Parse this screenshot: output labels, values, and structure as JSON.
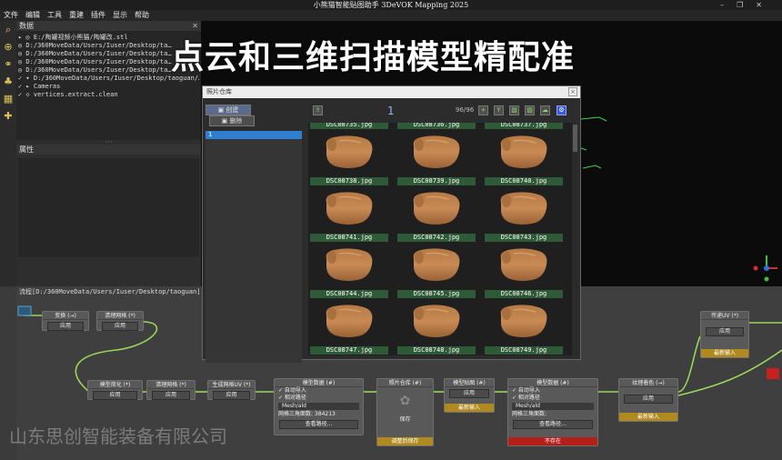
{
  "app": {
    "title": "小熊猫智能贴图助手 3DeVOK Mapping 2025"
  },
  "menu": [
    "文件",
    "编辑",
    "工具",
    "重建",
    "插件",
    "显示",
    "帮助"
  ],
  "data_panel": {
    "title": "数据",
    "tree": [
      "▸ ◎ E:/陶罐视频小熊猫/陶罐改.stl",
      "  ◎ D:/360MoveData/Users/Iuser/Desktop/ta…",
      "  ◎ D:/360MoveData/Users/Iuser/Desktop/ta…",
      "  ◎ D:/360MoveData/Users/Iuser/Desktop/ta…",
      "  ◎ D:/360MoveData/Users/Iuser/Desktop/ta…",
      "✓ ▾ D:/360MoveData/Users/Iuser/Desktop/taoguan/…",
      "  ✓ ▸ Cameras",
      "  ✓ ◇ vertices.extract.clean"
    ]
  },
  "props_panel": {
    "title": "属性"
  },
  "headline": "点云和三维扫描模型精配准",
  "flow": {
    "path": "流程[D:/360MoveData/Users/Iuser/Desktop/taoguan]",
    "nodes": {
      "n1": {
        "title": "变换 (→)",
        "btn": "应用"
      },
      "n2": {
        "title": "清理网格 (*)",
        "btn": "应用"
      },
      "n3": {
        "title": "模型简化 (*)",
        "btn": "应用"
      },
      "n4": {
        "title": "清理网格 (*)",
        "btn": "应用"
      },
      "n5": {
        "title": "生成网格UV (*)",
        "btn": "应用"
      },
      "n6": {
        "title": "模型数据 (#)",
        "c1": "✓ 自动导入",
        "c2": "✓ 相对路径",
        "f": "Mesh/ald",
        "s": "网格三角面数: 384213",
        "btn": "查看路径..."
      },
      "n7": {
        "title": "照片仓库 (#)",
        "btn": "保存",
        "yb": "调整后保存"
      },
      "n8": {
        "title": "模型贴图 (#)",
        "btn": "应用",
        "yb": "最新输入"
      },
      "n9": {
        "title": "模型数据 (#)",
        "c1": "✓ 自动导入",
        "c2": "✓ 相对路径",
        "f": "Mesh/ald",
        "s": "网格三角面数:",
        "btn": "查看路径...",
        "rb": "不存在"
      },
      "n10": {
        "title": "纹理着色 (→)",
        "btn": "应用",
        "yb": "最新输入"
      },
      "n11": {
        "title": "传递UV (*)",
        "btn": "应用",
        "yb": "最新输入"
      }
    }
  },
  "watermark": "山东思创智能装备有限公司",
  "dialog": {
    "title": "照片仓库",
    "create": "创建",
    "delete": "删除",
    "list_item": "1",
    "page": "1",
    "count": "96/96",
    "photos": [
      "DSC08735.jpg",
      "DSC08736.jpg",
      "DSC08737.jpg",
      "DSC08738.jpg",
      "DSC08739.jpg",
      "DSC08740.jpg",
      "DSC08741.jpg",
      "DSC08742.jpg",
      "DSC08743.jpg",
      "DSC08744.jpg",
      "DSC08745.jpg",
      "DSC08746.jpg",
      "DSC08747.jpg",
      "DSC08748.jpg",
      "DSC08749.jpg"
    ]
  },
  "colors": {
    "accent": "#2e7fd1",
    "wire": "#9cd65a",
    "jar": "#c98a55"
  }
}
